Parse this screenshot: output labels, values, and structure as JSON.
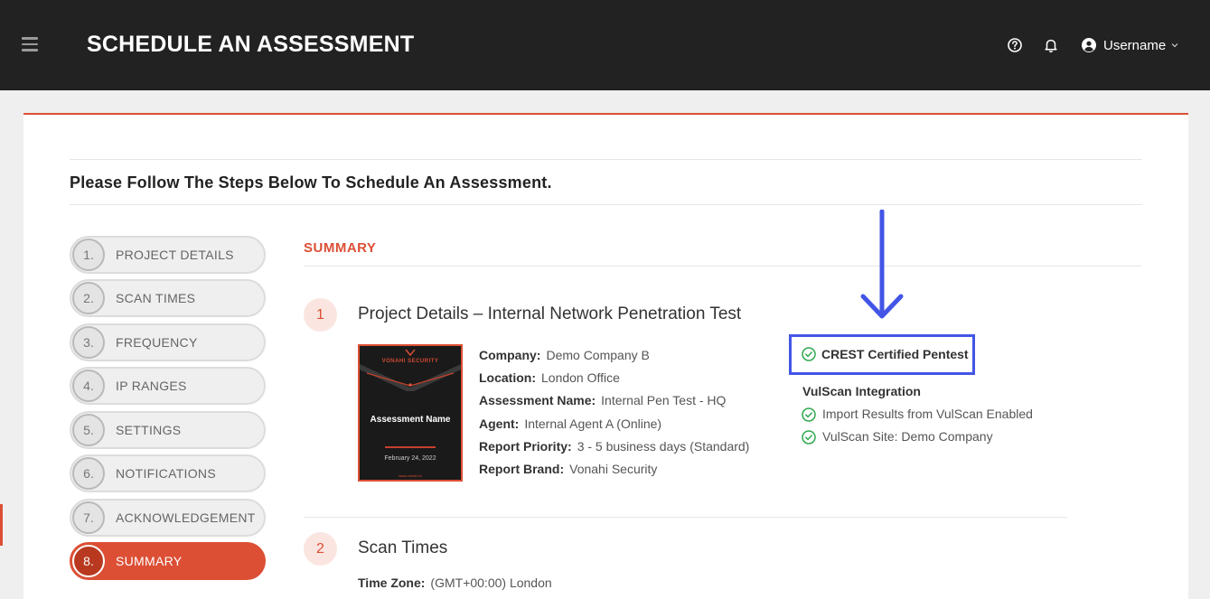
{
  "header": {
    "title": "SCHEDULE AN ASSESSMENT",
    "username": "Username",
    "icons": {
      "menu": "hamburger-menu-icon",
      "help": "help-circle-icon",
      "notifications": "bell-icon",
      "user": "user-circle-icon",
      "dropdown": "chevron-down-icon"
    }
  },
  "page": {
    "heading": "Please Follow The Steps Below To Schedule An Assessment."
  },
  "steps": [
    {
      "num": "1.",
      "label": "PROJECT DETAILS",
      "active": false
    },
    {
      "num": "2.",
      "label": "SCAN TIMES",
      "active": false
    },
    {
      "num": "3.",
      "label": "FREQUENCY",
      "active": false
    },
    {
      "num": "4.",
      "label": "IP RANGES",
      "active": false
    },
    {
      "num": "5.",
      "label": "SETTINGS",
      "active": false
    },
    {
      "num": "6.",
      "label": "NOTIFICATIONS",
      "active": false
    },
    {
      "num": "7.",
      "label": "ACKNOWLEDGEMENT",
      "active": false
    },
    {
      "num": "8.",
      "label": "SUMMARY",
      "active": true
    }
  ],
  "summary": {
    "title": "SUMMARY",
    "section1": {
      "number": "1",
      "title": "Project Details – Internal Network Penetration Test",
      "cover": {
        "brand": "VONAHI SECURITY",
        "title": "Assessment Name",
        "date": "February 24, 2022",
        "url": "www.vonahi.io"
      },
      "fields": [
        {
          "label": "Company:",
          "value": "Demo Company B"
        },
        {
          "label": "Location:",
          "value": "London Office"
        },
        {
          "label": "Assessment Name:",
          "value": "Internal Pen Test - HQ"
        },
        {
          "label": "Agent:",
          "value": "Internal Agent A (Online)"
        },
        {
          "label": "Report Priority:",
          "value": "3 - 5 business days (Standard)"
        },
        {
          "label": "Report Brand:",
          "value": "Vonahi Security"
        }
      ],
      "crest": "CREST Certified Pentest",
      "vulscan": {
        "heading": "VulScan Integration",
        "items": [
          "Import Results from VulScan Enabled",
          "VulScan Site: Demo Company"
        ]
      }
    },
    "section2": {
      "number": "2",
      "title": "Scan Times",
      "timezone_label": "Time Zone:",
      "timezone_value": "(GMT+00:00) London"
    }
  },
  "colors": {
    "accent": "#dc4f35",
    "header_bg": "#222222",
    "annotation": "#4355e6",
    "check": "#2fa84f"
  }
}
